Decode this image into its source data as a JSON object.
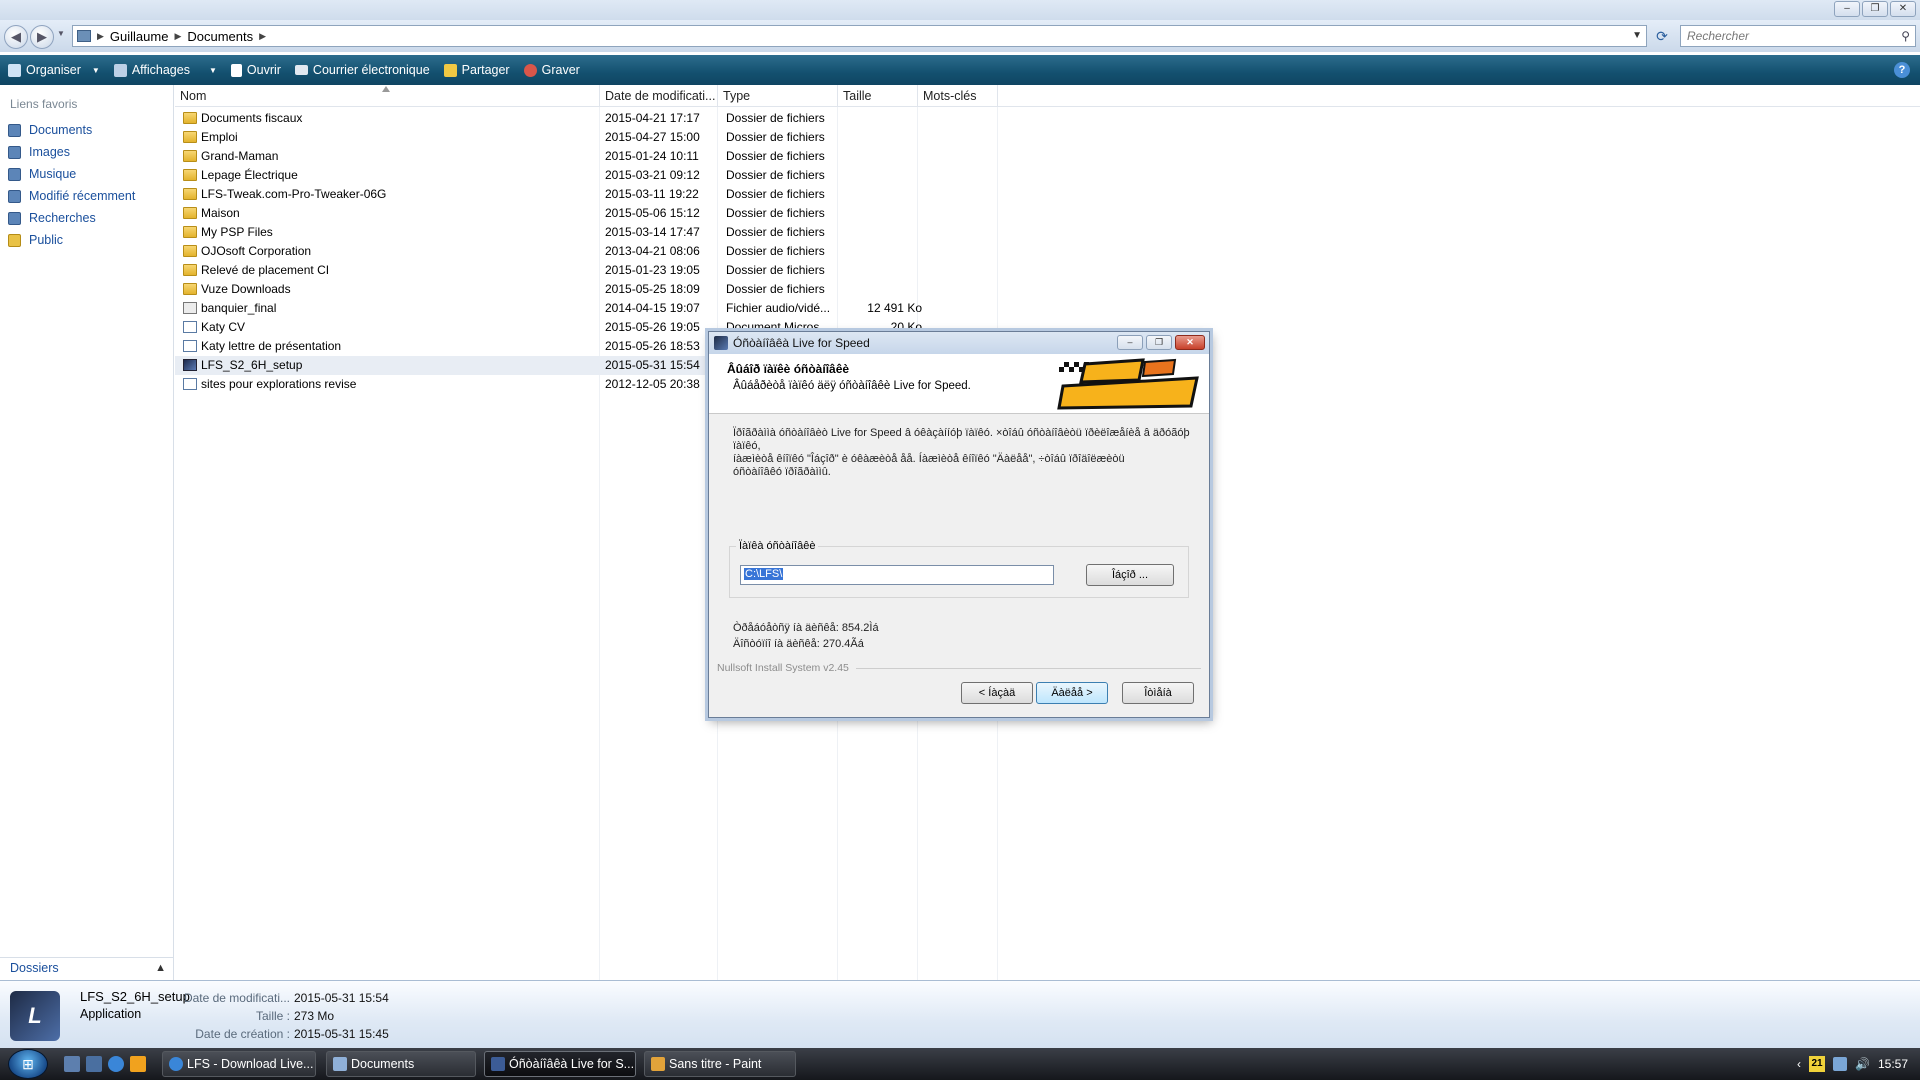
{
  "explorer": {
    "breadcrumb": [
      "Guillaume",
      "Documents"
    ],
    "search_placeholder": "Rechercher",
    "commands": [
      {
        "label": "Organiser",
        "has_dropdown": true,
        "icon": "organize-icon",
        "color": "#cfe3f5"
      },
      {
        "label": "Affichages",
        "has_dropdown": true,
        "icon": "views-icon",
        "color": "#bcd0e6"
      },
      {
        "label": "Ouvrir",
        "has_dropdown": false,
        "icon": "open-icon",
        "color": "#ffffff"
      },
      {
        "label": "Courrier électronique",
        "has_dropdown": false,
        "icon": "email-icon",
        "color": "#e1e8f0"
      },
      {
        "label": "Partager",
        "has_dropdown": false,
        "icon": "share-icon",
        "color": "#f1c843"
      },
      {
        "label": "Graver",
        "has_dropdown": false,
        "icon": "burn-icon",
        "color": "#d9564a"
      }
    ],
    "sidebar": {
      "heading": "Liens favoris",
      "items": [
        {
          "label": "Documents",
          "icon": "documents-icon"
        },
        {
          "label": "Images",
          "icon": "images-icon"
        },
        {
          "label": "Musique",
          "icon": "music-icon"
        },
        {
          "label": "Modifié récemment",
          "icon": "recent-icon"
        },
        {
          "label": "Recherches",
          "icon": "searches-icon"
        },
        {
          "label": "Public",
          "icon": "public-folder-icon"
        }
      ],
      "folders_label": "Dossiers"
    },
    "columns": [
      "Nom",
      "Date de modificati...",
      "Type",
      "Taille",
      "Mots-clés"
    ],
    "files": [
      {
        "name": "Documents fiscaux",
        "date": "2015-04-21 17:17",
        "type": "Dossier de fichiers",
        "size": "",
        "kind": "folder"
      },
      {
        "name": "Emploi",
        "date": "2015-04-27 15:00",
        "type": "Dossier de fichiers",
        "size": "",
        "kind": "folder"
      },
      {
        "name": "Grand-Maman",
        "date": "2015-01-24 10:11",
        "type": "Dossier de fichiers",
        "size": "",
        "kind": "folder"
      },
      {
        "name": "Lepage Électrique",
        "date": "2015-03-21 09:12",
        "type": "Dossier de fichiers",
        "size": "",
        "kind": "folder"
      },
      {
        "name": "LFS-Tweak.com-Pro-Tweaker-06G",
        "date": "2015-03-11 19:22",
        "type": "Dossier de fichiers",
        "size": "",
        "kind": "folder"
      },
      {
        "name": "Maison",
        "date": "2015-05-06 15:12",
        "type": "Dossier de fichiers",
        "size": "",
        "kind": "folder"
      },
      {
        "name": "My PSP Files",
        "date": "2015-03-14 17:47",
        "type": "Dossier de fichiers",
        "size": "",
        "kind": "folder"
      },
      {
        "name": "OJOsoft Corporation",
        "date": "2013-04-21 08:06",
        "type": "Dossier de fichiers",
        "size": "",
        "kind": "folder"
      },
      {
        "name": "Relevé de placement CI",
        "date": "2015-01-23 19:05",
        "type": "Dossier de fichiers",
        "size": "",
        "kind": "folder"
      },
      {
        "name": "Vuze Downloads",
        "date": "2015-05-25 18:09",
        "type": "Dossier de fichiers",
        "size": "",
        "kind": "folder"
      },
      {
        "name": "banquier_final",
        "date": "2014-04-15 19:07",
        "type": "Fichier audio/vidé...",
        "size": "12 491 Ko",
        "kind": "media"
      },
      {
        "name": "Katy CV",
        "date": "2015-05-26 19:05",
        "type": "Document Micros...",
        "size": "20 Ko",
        "kind": "doc"
      },
      {
        "name": "Katy lettre de présentation",
        "date": "2015-05-26 18:53",
        "type": "",
        "size": "",
        "kind": "doc"
      },
      {
        "name": "LFS_S2_6H_setup",
        "date": "2015-05-31 15:54",
        "type": "",
        "size": "",
        "kind": "app",
        "selected": true
      },
      {
        "name": "sites pour explorations revise",
        "date": "2012-12-05 20:38",
        "type": "",
        "size": "",
        "kind": "doc"
      }
    ],
    "details": {
      "name": "LFS_S2_6H_setup",
      "kind": "Application",
      "modified_label": "Date de modificati...",
      "modified_value": "2015-05-31 15:54",
      "size_label": "Taille :",
      "size_value": "273 Mo",
      "created_label": "Date de création :",
      "created_value": "2015-05-31 15:45"
    }
  },
  "dialog": {
    "title": "Óñòàíîâêà Live for Speed",
    "header_title": "Âûáîð ïàïêè óñòàíîâêè",
    "header_subtitle": "Âûáåðèòå ïàïêó äëÿ óñòàíîâêè Live for Speed.",
    "body_lines": [
      "Ïðîãðàììà óñòàíîâèò Live for Speed â óêàçàííóþ ïàïêó. ×òîáû óñòàíîâèòü ïðèëîæåíèå â äðóãóþ ïàïêó,",
      "íàæìèòå êíîïêó \"Îáçîð\" è óêàæèòå åå. Íàæìèòå êíîïêó \"Äàëåå\", ÷òîáû ïðîäîëæèòü",
      "óñòàíîâêó ïðîãðàììû."
    ],
    "group_label": "Ïàïêà óñòàíîâêè",
    "path_value": "C:\\LFS\\",
    "browse_label": "Îáçîð ...",
    "space_required": "Òðåáóåòñÿ íà äèñêå: 854.2Ìá",
    "space_available": "Äîñòóïíî íà äèñêå: 270.4Ãá",
    "nsis": "Nullsoft Install System v2.45",
    "back_label": "< Íàçàä",
    "next_label": "Äàëåå >",
    "cancel_label": "Îòìåíà"
  },
  "taskbar": {
    "tasks": [
      {
        "label": "LFS - Download Live...",
        "icon_color": "#3a86d8"
      },
      {
        "label": "Documents",
        "icon_color": "#8fb0d8"
      },
      {
        "label": "Óñòàíîâêà Live for S...",
        "icon_color": "#3c5c96",
        "active": true
      },
      {
        "label": "Sans titre - Paint",
        "icon_color": "#e2a33a"
      }
    ],
    "calendar_day": "21",
    "clock": "15:57"
  }
}
